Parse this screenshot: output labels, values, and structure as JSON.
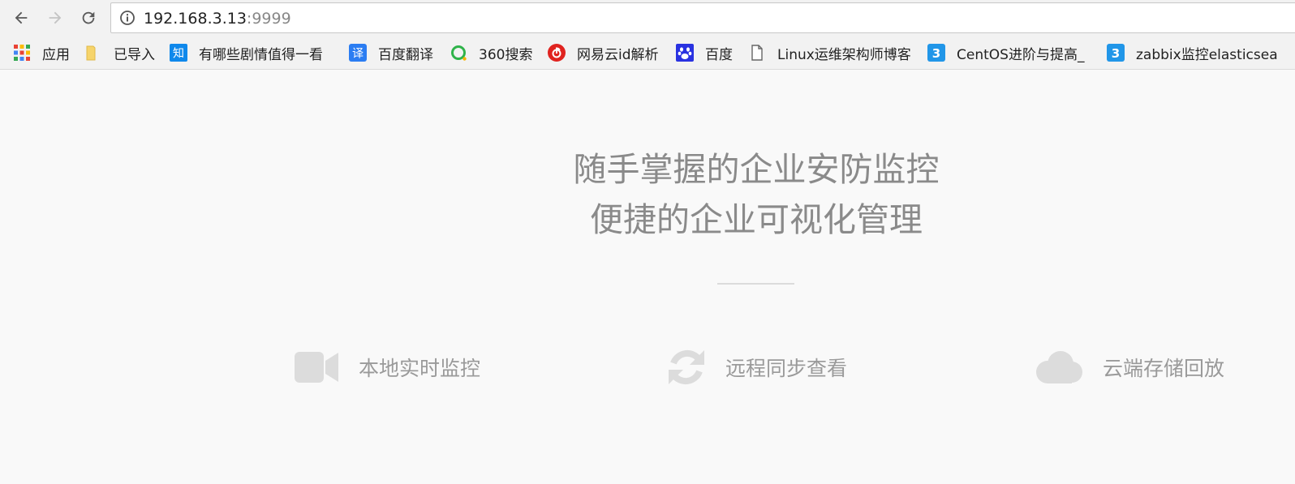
{
  "browser": {
    "url_host": "192.168.3.13",
    "url_port": ":9999",
    "icons": {
      "back": "back-arrow-icon",
      "forward": "forward-arrow-icon",
      "reload": "reload-icon",
      "info": "info-icon"
    }
  },
  "bookmarks": [
    {
      "label": "应用",
      "icon": "apps-grid-icon"
    },
    {
      "label": "已导入",
      "icon": "folder-icon"
    },
    {
      "label": "有哪些剧情值得一看",
      "icon": "zhihu-icon"
    },
    {
      "label": "百度翻译",
      "icon": "translate-icon"
    },
    {
      "label": "360搜索",
      "icon": "360-search-icon"
    },
    {
      "label": "网易云id解析",
      "icon": "netease-music-icon"
    },
    {
      "label": "百度",
      "icon": "baidu-paw-icon"
    },
    {
      "label": "Linux运维架构师博客",
      "icon": "page-icon"
    },
    {
      "label": "CentOS进阶与提高_",
      "icon": "site-3-icon"
    },
    {
      "label": "zabbix监控elasticsea",
      "icon": "site-3-icon"
    }
  ],
  "hero": {
    "line1": "随手掌握的企业安防监控",
    "line2": "便捷的企业可视化管理"
  },
  "features": [
    {
      "label": "本地实时监控",
      "icon": "video-camera-icon"
    },
    {
      "label": "远程同步查看",
      "icon": "sync-icon"
    },
    {
      "label": "云端存储回放",
      "icon": "cloud-icon"
    }
  ],
  "colors": {
    "page_bg": "#f9f9f9",
    "hero_text": "#8a8a8a",
    "feature_icon": "#dcdcdc",
    "feature_text": "#9a9a9a"
  }
}
